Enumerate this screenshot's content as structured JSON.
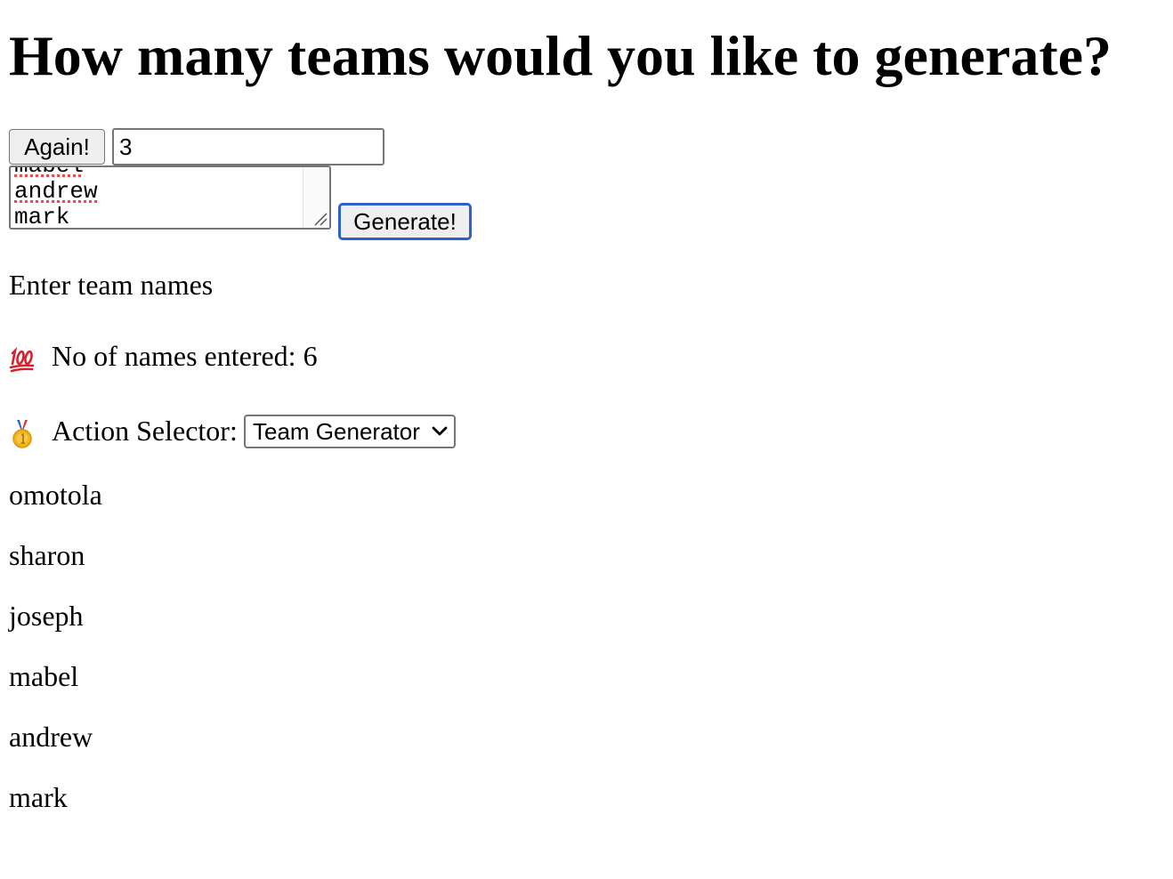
{
  "heading": "How many teams would you like to generate?",
  "controls": {
    "again_label": "Again!",
    "team_count_value": "3",
    "generate_label": "Generate!"
  },
  "names_textarea": {
    "visible_lines": [
      "mabel",
      "andrew",
      "mark"
    ]
  },
  "info": {
    "enter_team_names": "Enter team names",
    "hundred_emoji": "hundred-points-emoji",
    "names_entered_label": "No of names entered: 6",
    "medal_emoji": "first-place-medal-emoji",
    "action_selector_label": "Action Selector:",
    "action_selected": "Team Generator"
  },
  "names_list": [
    "omotola",
    "sharon",
    "joseph",
    "mabel",
    "andrew",
    "mark"
  ],
  "colors": {
    "focus_ring": "#2f62c9",
    "spellcheck_underline": "#e05050",
    "hundred_emoji": "#d8202c",
    "medal_gold": "#f2b21a"
  }
}
